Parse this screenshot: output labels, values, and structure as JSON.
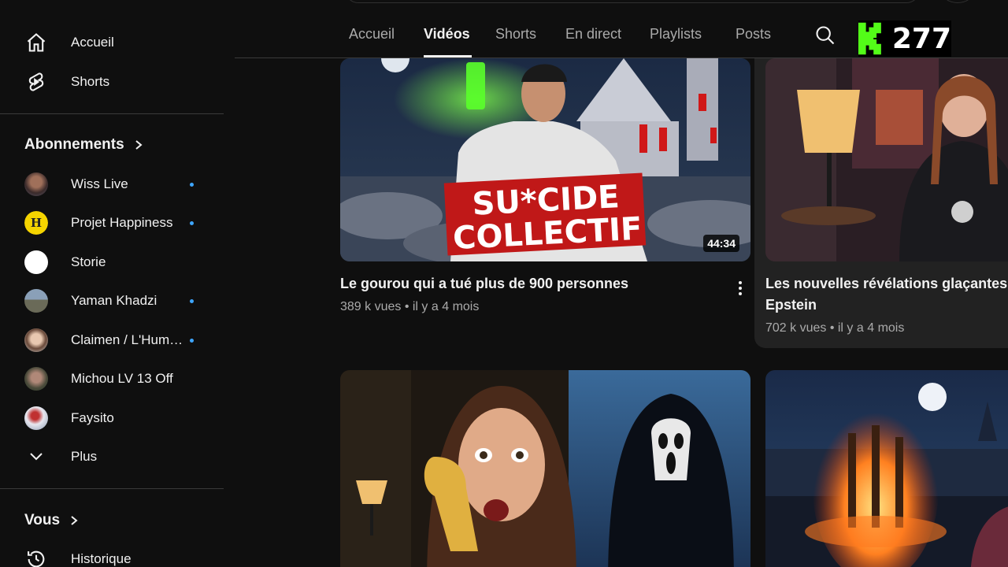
{
  "sidebar": {
    "top_items": [
      {
        "label": "Accueil",
        "icon": "home-icon"
      },
      {
        "label": "Shorts",
        "icon": "shorts-icon"
      }
    ],
    "subscriptions_heading": "Abonnements",
    "subscriptions": [
      {
        "label": "Wiss Live",
        "new": true
      },
      {
        "label": "Projet Happiness",
        "new": true
      },
      {
        "label": "Storie",
        "new": false
      },
      {
        "label": "Yaman Khadzi",
        "new": true
      },
      {
        "label": "Claimen / L'Hum…",
        "new": true
      },
      {
        "label": "Michou LV 13 Off",
        "new": false
      },
      {
        "label": "Faysito",
        "new": false
      }
    ],
    "more_label": "Plus",
    "you_heading": "Vous",
    "history_label": "Historique"
  },
  "tabs": [
    {
      "label": "Accueil",
      "active": false
    },
    {
      "label": "Vidéos",
      "active": true
    },
    {
      "label": "Shorts",
      "active": false
    },
    {
      "label": "En direct",
      "active": false
    },
    {
      "label": "Playlists",
      "active": false
    },
    {
      "label": "Posts",
      "active": false
    }
  ],
  "kick_overlay": {
    "count": "277",
    "color": "#53fc18"
  },
  "videos": [
    {
      "thumb_text_1": "SU*CIDE",
      "thumb_text_2": "COLLECTIF",
      "duration": "44:34",
      "title": "Le gourou qui a tué plus de 900 personnes",
      "meta": "389 k vues • il y a 4 mois"
    },
    {
      "title_line_1": "Les nouvelles révélations glaçantes",
      "title_line_2": "Epstein",
      "meta": "702 k vues • il y a 4 mois"
    }
  ],
  "colors": {
    "background": "#0f0f0f",
    "accent_dot": "#3ea6ff",
    "text_secondary": "#aaaaaa"
  }
}
